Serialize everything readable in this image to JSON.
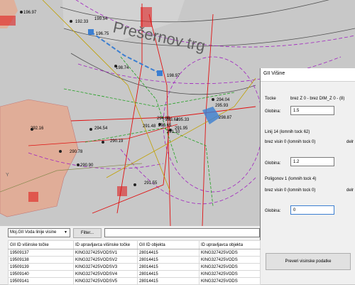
{
  "map": {
    "place_name": "Prešernov trg",
    "point_labels": [
      "196.97",
      "192.33",
      "199.54",
      "196.75",
      "198.74",
      "198.97",
      "294.04",
      "292.16",
      "294.54",
      "290.19",
      "291.48",
      "290.65",
      "294.89",
      "293.64",
      "291.55",
      "290.78",
      "295.33",
      "290.90",
      "291.10",
      "291.95",
      "295.93",
      "298.87"
    ]
  },
  "panel": {
    "title": "GII Višine",
    "tocke_label": "Tocke",
    "tocke_value": "brez Z 0 - brez DIM_Z 0 - (8)",
    "globina_label": "Globina:",
    "globina1_value": "1.5",
    "linij_label": "Linij 14 (lomnih tock 62)",
    "brez_visin_1": "brez visin 0 (lomnih tock 0)",
    "del_1": "delr",
    "globina2_value": "1.2",
    "poligonov_label": "Poligonov 1 (lomnih tock 4)",
    "brez_visin_2": "brez visin 0 (lomnih tock 0)",
    "del_2": "delr",
    "globina3_value": "0",
    "button_label": "Preveri visinske podatke"
  },
  "bottom": {
    "dropdown_value": "Moj.GII Voda linije visine",
    "filter_label": "Filter...",
    "table": {
      "headers": [
        "GII ID višinske točke",
        "ID upravljavca višinske točke",
        "GII ID objekta",
        "ID upravljavca objekta"
      ],
      "rows": [
        [
          "19509137",
          "KING327425VODSV1",
          "28014415",
          "KING327425VODS"
        ],
        [
          "19509138",
          "KING327425VODSV2",
          "28014415",
          "KING327425VODS"
        ],
        [
          "19509139",
          "KING327425VODSV3",
          "28014415",
          "KING327425VODS"
        ],
        [
          "19509140",
          "KING327425VODSV4",
          "28014415",
          "KING327425VODS"
        ],
        [
          "19509141",
          "KING327425VODSV5",
          "28014415",
          "KING327425VODS"
        ]
      ]
    }
  },
  "colors": {
    "panel_bg": "#f0f0f0",
    "map_bg": "#c8c8c8",
    "accent_blue": "#3c7fd1",
    "parcel_salmon": "#e8a588",
    "line_red": "#e01010",
    "line_magenta": "#a020c0"
  }
}
